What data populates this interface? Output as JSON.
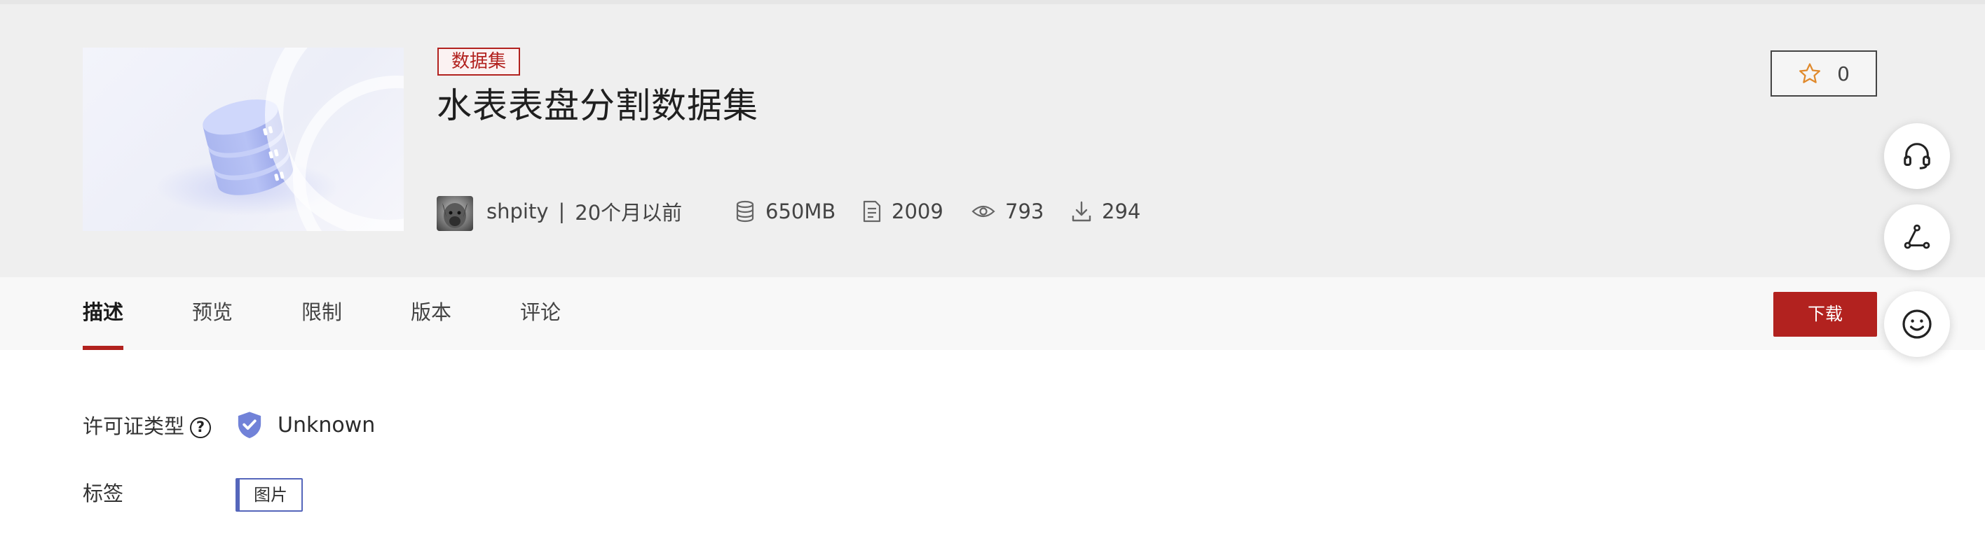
{
  "dataset": {
    "type_label": "数据集",
    "title": "水表表盘分割数据集"
  },
  "author": {
    "name": "shpity",
    "separator": "|",
    "time": "20个月以前"
  },
  "stats": {
    "size": "650MB",
    "files": "2009",
    "views": "793",
    "downloads": "294"
  },
  "star": {
    "count": "0"
  },
  "tabs": [
    "描述",
    "预览",
    "限制",
    "版本",
    "评论"
  ],
  "download_label": "下载",
  "license": {
    "label": "许可证类型",
    "help_glyph": "?",
    "value": "Unknown"
  },
  "tags": {
    "label": "标签",
    "items": [
      "图片"
    ]
  },
  "colors": {
    "accent": "#b2221f",
    "icon_blue": "#6d7fd6",
    "tag_border": "#5566bb"
  }
}
